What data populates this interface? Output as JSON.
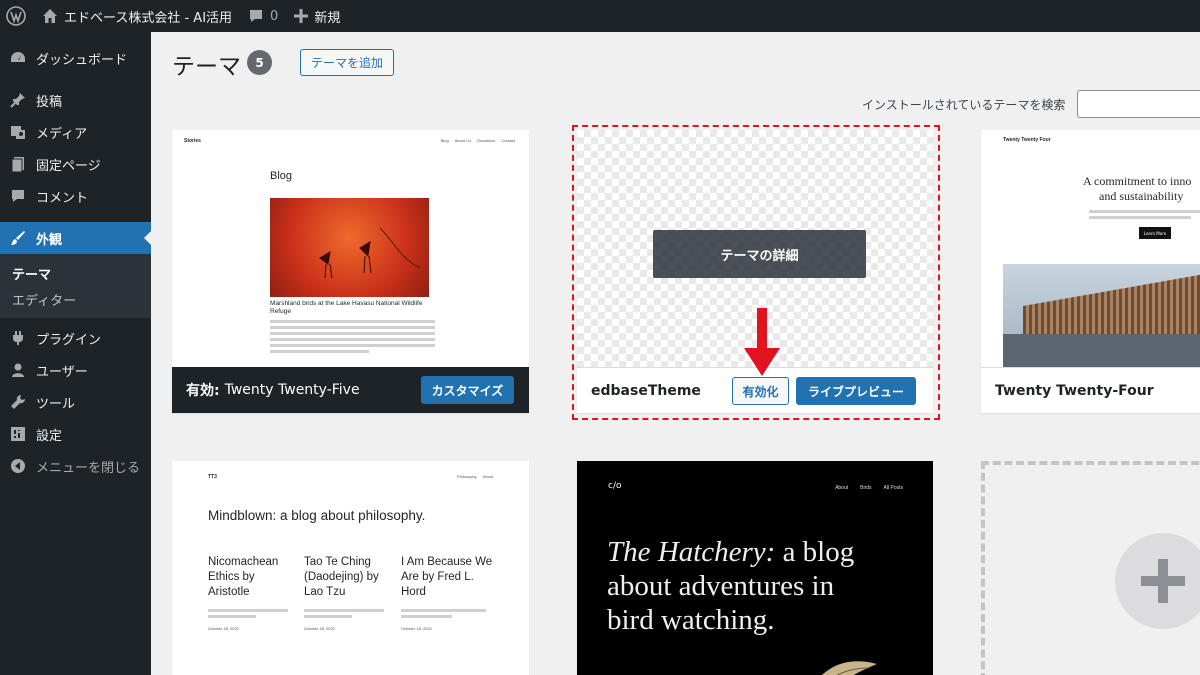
{
  "adminbar": {
    "site_name": "エドベース株式会社 - AI活用",
    "comments_count": "0",
    "new_label": "新規"
  },
  "sidebar": {
    "items": [
      {
        "label": "ダッシュボード",
        "icon": "dashboard-icon"
      },
      {
        "label": "投稿",
        "icon": "pin-icon"
      },
      {
        "label": "メディア",
        "icon": "media-icon"
      },
      {
        "label": "固定ページ",
        "icon": "page-icon"
      },
      {
        "label": "コメント",
        "icon": "comment-icon"
      },
      {
        "label": "外観",
        "icon": "brush-icon"
      },
      {
        "label": "プラグイン",
        "icon": "plugin-icon"
      },
      {
        "label": "ユーザー",
        "icon": "user-icon"
      },
      {
        "label": "ツール",
        "icon": "wrench-icon"
      },
      {
        "label": "設定",
        "icon": "settings-icon"
      }
    ],
    "appearance_sub": {
      "themes": "テーマ",
      "editor": "エディター"
    },
    "collapse_label": "メニューを閉じる"
  },
  "main": {
    "title": "テーマ",
    "count": "5",
    "add_button": "テーマを追加",
    "search_label": "インストールされているテーマを検索"
  },
  "themes": {
    "tt5": {
      "active_prefix": "有効:",
      "name": "Twenty Twenty-Five",
      "customize": "カスタマイズ",
      "preview": {
        "site": "Stories",
        "nav": [
          "Blog",
          "About Us",
          "Donations",
          "Contact"
        ],
        "heading": "Blog",
        "post_title": "Marshland birds at the Lake Havasu National Wildlife Refuge"
      }
    },
    "edbase": {
      "name": "edbaseTheme",
      "details": "テーマの詳細",
      "activate": "有効化",
      "live_preview": "ライブプレビュー"
    },
    "tt4": {
      "name": "Twenty Twenty-Four",
      "preview": {
        "site": "Twenty Twenty Four",
        "headline_1": "A commitment to inno",
        "headline_2": "and sustainability",
        "button": "Learn More"
      }
    },
    "tt3": {
      "preview": {
        "site": "TT3",
        "nav": [
          "Philosophy",
          "About"
        ],
        "headline": "Mindblown: a blog about philosophy.",
        "books": [
          {
            "title": "Nicomachean Ethics by Aristotle",
            "date": "October 18, 2022"
          },
          {
            "title": "Tao Te Ching (Daodejing) by Lao Tzu",
            "date": "October 18, 2022"
          },
          {
            "title": "I Am Because We Are by Fred L. Hord",
            "date": "October 18, 2022"
          }
        ]
      }
    },
    "hatchery": {
      "preview": {
        "logo": "c/o",
        "nav": [
          "About",
          "Birds",
          "All Posts"
        ],
        "headline_italic": "The Hatchery:",
        "headline_rest_1": " a blog",
        "headline_2": "about adventures in",
        "headline_3": "bird watching."
      }
    }
  },
  "colors": {
    "wp_blue": "#2271b1",
    "admin_dark": "#1d2327",
    "highlight_red": "#e0141e"
  }
}
